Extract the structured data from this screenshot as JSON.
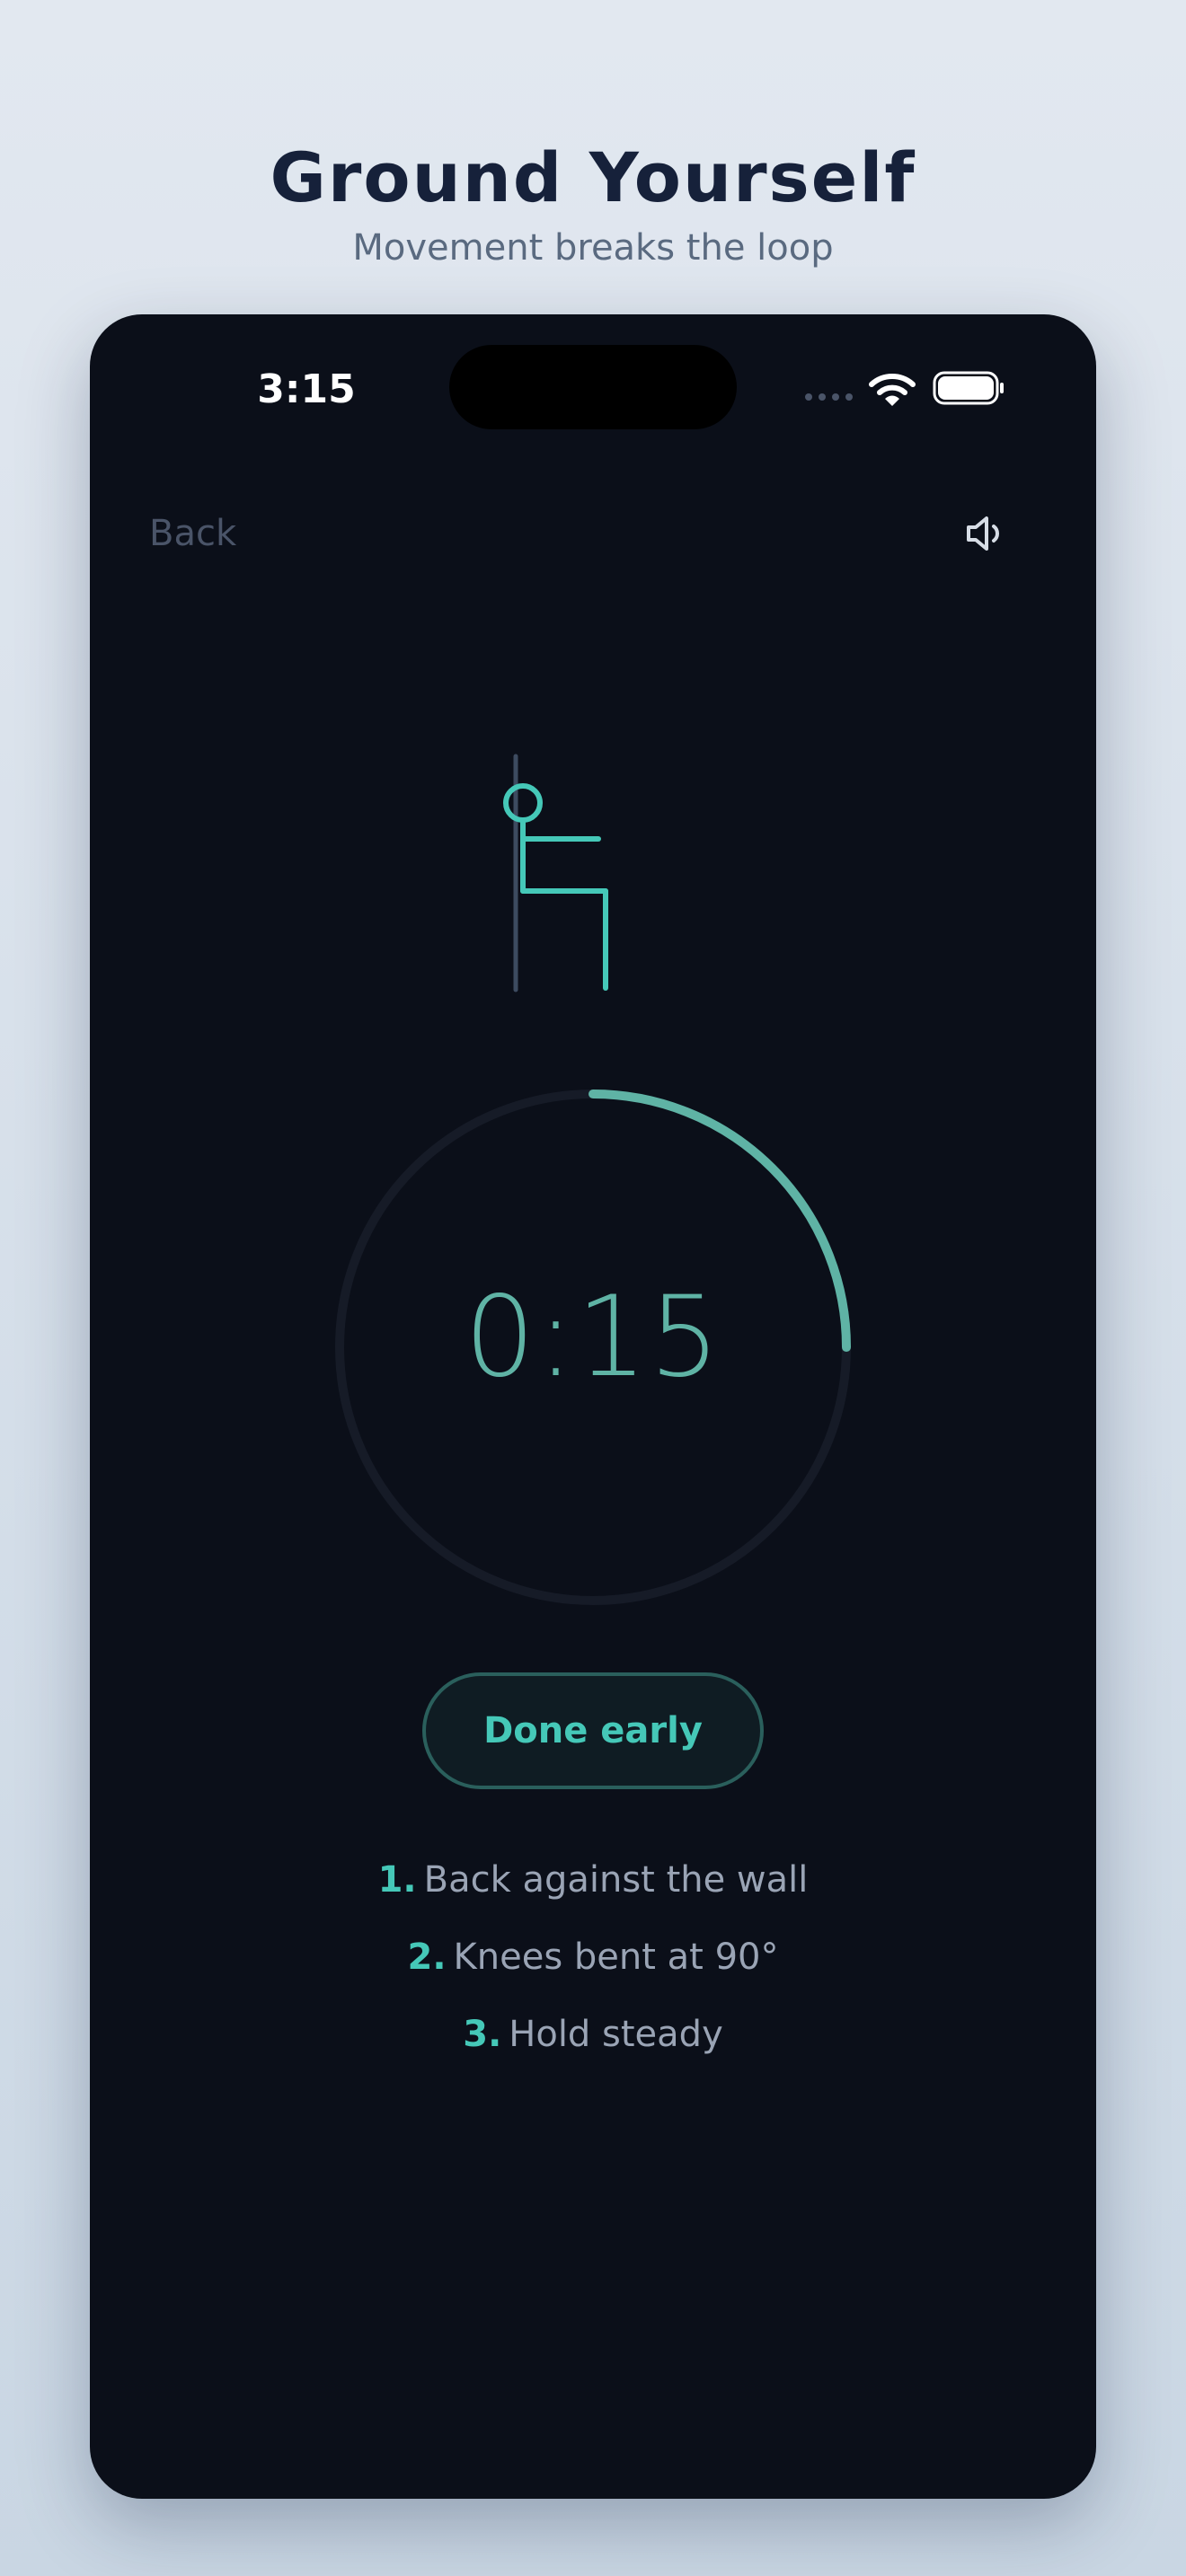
{
  "header": {
    "title": "Ground Yourself",
    "subtitle": "Movement breaks the loop"
  },
  "status_bar": {
    "time": "3:15"
  },
  "nav": {
    "back_label": "Back",
    "sound_icon": "speaker-icon"
  },
  "exercise": {
    "illustration": "wall-sit-figure",
    "timer": "0:15",
    "progress": 0.25,
    "done_label": "Done early",
    "steps": [
      {
        "num": "1.",
        "text": "Back against the wall"
      },
      {
        "num": "2.",
        "text": "Knees bent at 90°"
      },
      {
        "num": "3.",
        "text": "Hold steady"
      }
    ]
  },
  "colors": {
    "background": "#0b0f19",
    "accent": "#45c8b8",
    "ring_progress": "#5fb3a5",
    "ring_track": "#161b27"
  }
}
